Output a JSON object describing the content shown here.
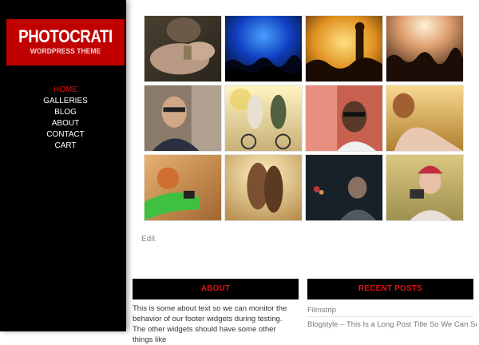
{
  "site": {
    "title": "PHOTOCRATI",
    "subtitle": "WORDPRESS THEME"
  },
  "nav": {
    "items": [
      "HOME",
      "GALLERIES",
      "BLOG",
      "ABOUT",
      "CONTACT",
      "CART"
    ],
    "active": "HOME"
  },
  "gallery": {
    "thumbnails": [
      "hands-with-keys-photo",
      "concert-blue-lights-photo",
      "concert-guitarist-photo",
      "concert-crowd-stage-photo",
      "smiling-man-sunglasses-photo",
      "couple-on-bicycles-photo",
      "woman-in-glasses-photo",
      "woman-in-field-photo",
      "child-in-car-window-photo",
      "couple-kissing-photo",
      "woman-at-window-photo",
      "girl-with-camera-photo"
    ]
  },
  "post": {
    "edit_label": "Edit"
  },
  "footer": {
    "about": {
      "heading": "ABOUT",
      "text": "This is some about text so we can monitor the behavior of our footer widgets during testing. The other widgets should have some other things like"
    },
    "recent_posts": {
      "heading": "RECENT POSTS",
      "items": [
        "Filmstrip",
        "Blogstyle – This Is a Long Post Title So We Can See"
      ]
    }
  },
  "colors": {
    "sidebar": "#000000",
    "logo_bg": "#c00000",
    "accent_red": "#e01010"
  }
}
